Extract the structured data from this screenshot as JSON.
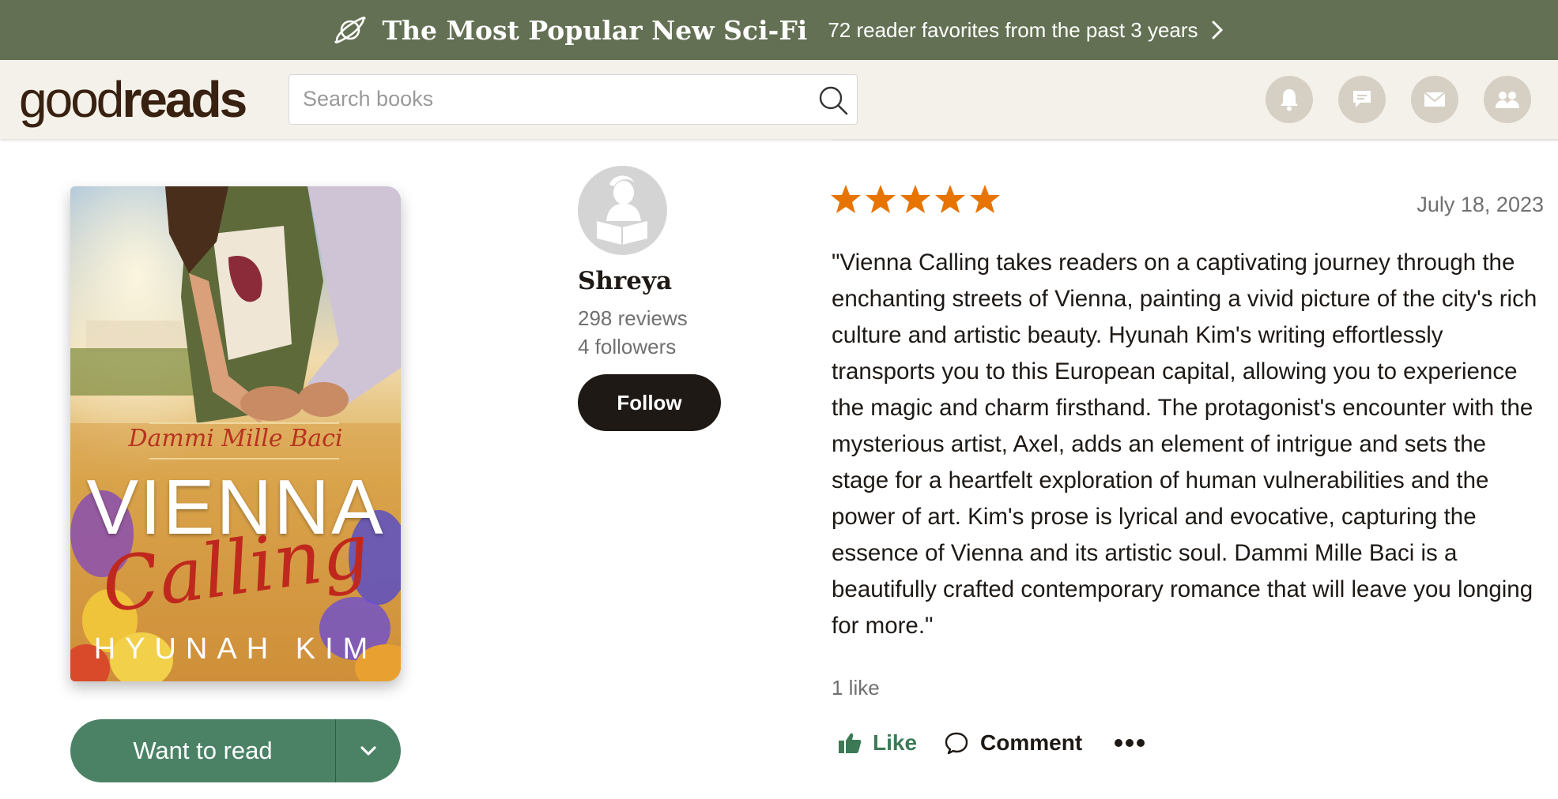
{
  "promo": {
    "icon": "planet-icon",
    "title": "The Most Popular New Sci-Fi",
    "subtitle": "72 reader favorites from the past 3 years"
  },
  "header": {
    "logo_good": "good",
    "logo_reads": "reads",
    "search_placeholder": "Search books",
    "nav_icons": [
      "bell-icon",
      "chat-icon",
      "mail-icon",
      "friends-icon"
    ]
  },
  "book": {
    "cover": {
      "series": "Dammi Mille Baci",
      "title_line1": "VIENNA",
      "title_line2": "Calling",
      "author": "HYUNAH KIM"
    },
    "shelf_button": "Want to read"
  },
  "reviewer": {
    "name": "Shreya",
    "reviews": "298 reviews",
    "followers": "4 followers",
    "follow_label": "Follow"
  },
  "review": {
    "rating": 5,
    "max_rating": 5,
    "star_color": "#e87400",
    "date": "July 18, 2023",
    "text": "\"Vienna Calling takes readers on a captivating journey through the enchanting streets of Vienna, painting a vivid picture of the city's rich culture and artistic beauty. Hyunah Kim's writing effortlessly transports you to this European capital, allowing you to experience the magic and charm firsthand. The protagonist's encounter with the mysterious artist, Axel, adds an element of intrigue and sets the stage for a heartfelt exploration of human vulnerabilities and the power of art. Kim's prose is lyrical and evocative, capturing the essence of Vienna and its artistic soul. Dammi Mille Baci is a beautifully crafted contemporary romance that will leave you longing for more.\"",
    "likes_count": "1 like",
    "like_label": "Like",
    "comment_label": "Comment"
  },
  "colors": {
    "promo_bg": "#637053",
    "header_bg": "#f4f1ea",
    "shelf_button": "#4b8266",
    "follow_button": "#1e1915"
  }
}
